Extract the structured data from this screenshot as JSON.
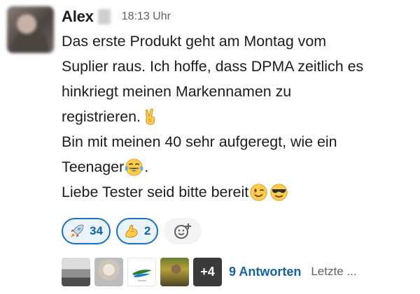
{
  "message": {
    "author": "Alex",
    "timestamp": "18:13 Uhr",
    "lines": [
      "Das erste Produkt geht am Montag vom",
      "Suplier raus. Ich hoffe, dass DPMA zeitlich es",
      "hinkriegt meinen Markennamen zu",
      "registrieren.",
      "Bin mit meinen 40 sehr aufgeregt, wie ein",
      "Teenager",
      "Liebe Tester seid bitte bereit"
    ],
    "inline_text": {
      "after_laughing_emoji": "."
    }
  },
  "emojis": {
    "victory": "victory-hand-emoji",
    "laughing": "tears-of-joy-emoji",
    "wink": "winking-face-emoji",
    "sunglasses": "smiling-face-with-sunglasses-emoji"
  },
  "reactions": [
    {
      "icon": "rocket-icon",
      "count": "34"
    },
    {
      "icon": "flexed-biceps-icon",
      "count": "2"
    }
  ],
  "add_reaction": {
    "icon": "add-reaction-icon"
  },
  "thread": {
    "more_count": "+4",
    "replies_label": "9 Antworten",
    "last_reply_label": "Letzte ..."
  },
  "colors": {
    "link": "#1264a3",
    "reaction_bg": "#e8f3fb",
    "reaction_border": "#1d6ec2",
    "muted": "#616061"
  }
}
